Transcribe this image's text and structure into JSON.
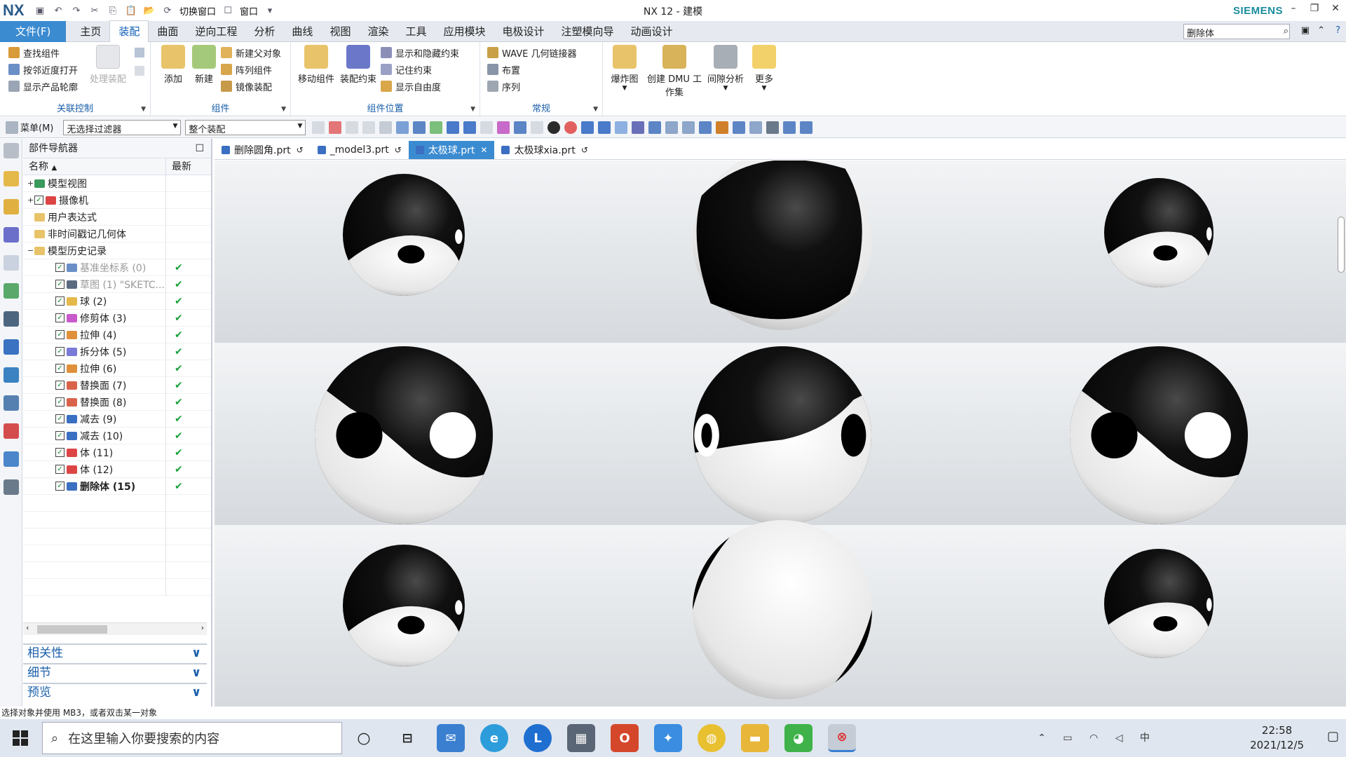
{
  "app": {
    "logo": "NX",
    "window_title": "NX 12 - 建模",
    "brand": "SIEMENS",
    "switch_window": "切换窗口",
    "window_menu": "窗口"
  },
  "menubar": {
    "file": "文件(F)",
    "tabs": [
      "主页",
      "装配",
      "曲面",
      "逆向工程",
      "分析",
      "曲线",
      "视图",
      "渲染",
      "工具",
      "应用模块",
      "电极设计",
      "注塑模向导",
      "动画设计"
    ],
    "active_tab": "装配",
    "command_search_value": "删除体"
  },
  "ribbon": {
    "groups": [
      {
        "label": "关联控制",
        "small": [
          "查找组件",
          "按邻近度打开",
          "显示产品轮廓"
        ],
        "big": [
          "处理装配"
        ]
      },
      {
        "label": "组件",
        "big": [
          "添加",
          "新建"
        ],
        "small": [
          "新建父对象",
          "阵列组件",
          "镜像装配"
        ]
      },
      {
        "label": "组件位置",
        "big": [
          "移动组件",
          "装配约束"
        ],
        "small": [
          "显示和隐藏约束",
          "记住约束",
          "显示自由度"
        ]
      },
      {
        "label": "常规",
        "small": [
          "WAVE 几何链接器",
          "布置",
          "序列"
        ]
      },
      {
        "big_labels": [
          "爆炸图",
          "创建 DMU 工作集",
          "间隙分析",
          "更多"
        ]
      }
    ]
  },
  "toolbar2": {
    "menu": "菜单(M)",
    "filter": "无选择过滤器",
    "scope": "整个装配"
  },
  "navigator": {
    "title": "部件导航器",
    "col_name": "名称",
    "col_latest": "最新",
    "rows": [
      {
        "label": "模型视图",
        "level": 0,
        "expander": "+",
        "check": false,
        "latest": "",
        "style": ""
      },
      {
        "label": "摄像机",
        "level": 0,
        "expander": "+",
        "check": true,
        "latest": "",
        "style": ""
      },
      {
        "label": "用户表达式",
        "level": 0,
        "expander": "",
        "check": false,
        "latest": "",
        "style": ""
      },
      {
        "label": "非时间戳记几何体",
        "level": 0,
        "expander": "",
        "check": false,
        "latest": "",
        "style": ""
      },
      {
        "label": "模型历史记录",
        "level": 0,
        "expander": "−",
        "check": false,
        "latest": "",
        "style": ""
      },
      {
        "label": "基准坐标系 (0)",
        "level": 1,
        "check": true,
        "latest": "✔",
        "style": "grey"
      },
      {
        "label": "草图 (1) \"SKETC...",
        "level": 1,
        "check": true,
        "latest": "✔",
        "style": "grey"
      },
      {
        "label": "球 (2)",
        "level": 1,
        "check": true,
        "latest": "✔",
        "style": ""
      },
      {
        "label": "修剪体 (3)",
        "level": 1,
        "check": true,
        "latest": "✔",
        "style": ""
      },
      {
        "label": "拉伸 (4)",
        "level": 1,
        "check": true,
        "latest": "✔",
        "style": ""
      },
      {
        "label": "拆分体 (5)",
        "level": 1,
        "check": true,
        "latest": "✔",
        "style": ""
      },
      {
        "label": "拉伸 (6)",
        "level": 1,
        "check": true,
        "latest": "✔",
        "style": ""
      },
      {
        "label": "替换面 (7)",
        "level": 1,
        "check": true,
        "latest": "✔",
        "style": ""
      },
      {
        "label": "替换面 (8)",
        "level": 1,
        "check": true,
        "latest": "✔",
        "style": ""
      },
      {
        "label": "减去 (9)",
        "level": 1,
        "check": true,
        "latest": "✔",
        "style": ""
      },
      {
        "label": "减去 (10)",
        "level": 1,
        "check": true,
        "latest": "✔",
        "style": ""
      },
      {
        "label": "体 (11)",
        "level": 1,
        "check": true,
        "latest": "✔",
        "style": ""
      },
      {
        "label": "体 (12)",
        "level": 1,
        "check": true,
        "latest": "✔",
        "style": ""
      },
      {
        "label": "删除体 (15)",
        "level": 1,
        "check": true,
        "latest": "✔",
        "style": "bold"
      }
    ],
    "panels": [
      "相关性",
      "细节",
      "预览"
    ]
  },
  "doc_tabs": [
    {
      "label": "删除圆角.prt",
      "active": false
    },
    {
      "label": "_model3.prt",
      "active": false
    },
    {
      "label": "太极球.prt",
      "active": true
    },
    {
      "label": "太极球xia.prt",
      "active": false
    }
  ],
  "status": "选择对象并使用 MB3，或者双击某一对象",
  "taskbar": {
    "search_placeholder": "在这里输入你要搜索的内容",
    "time": "22:58",
    "date": "2021/12/5"
  },
  "colors": {
    "accent": "#3b8bd1",
    "brand": "#1b8c9c",
    "check": "#19a13a"
  }
}
